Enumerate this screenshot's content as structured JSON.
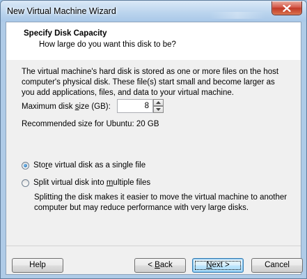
{
  "window": {
    "title": "New Virtual Machine Wizard",
    "close_icon": "close-x-icon"
  },
  "header": {
    "title": "Specify Disk Capacity",
    "subtitle": "How large do you want this disk to be?"
  },
  "body": {
    "description": "The virtual machine's hard disk is stored as one or more files on the host computer's physical disk. These file(s) start small and become larger as you add applications, files, and data to your virtual machine.",
    "max_size_label_pre": "Maximum disk ",
    "max_size_label_u": "s",
    "max_size_label_post": "ize (GB):",
    "max_size_value": "8",
    "recommended": "Recommended size for Ubuntu: 20 GB",
    "option_single_pre": "Sto",
    "option_single_u": "r",
    "option_single_post": "e virtual disk as a single file",
    "option_single_checked": true,
    "option_split_pre": "Split virtual disk into ",
    "option_split_u": "m",
    "option_split_post": "ultiple files",
    "option_split_checked": false,
    "split_note": "Splitting the disk makes it easier to move the virtual machine to another computer but may reduce performance with very large disks."
  },
  "buttons": {
    "help": "Help",
    "back_pre": "< ",
    "back_u": "B",
    "back_post": "ack",
    "next_u": "N",
    "next_post": "ext >",
    "cancel": "Cancel"
  }
}
